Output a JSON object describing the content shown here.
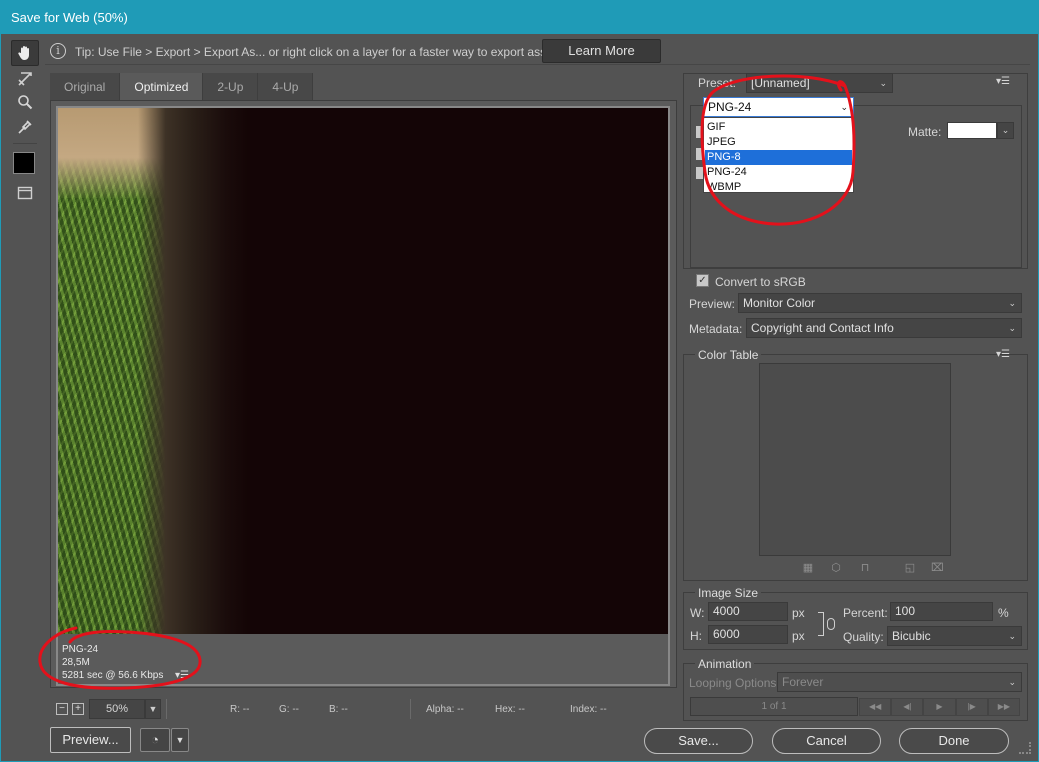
{
  "window": {
    "title": "Save for Web (50%)"
  },
  "tools": [
    {
      "name": "hand-tool-icon",
      "active": true
    },
    {
      "name": "slice-select-tool-icon",
      "active": false
    },
    {
      "name": "zoom-tool-icon",
      "active": false
    },
    {
      "name": "eyedropper-tool-icon",
      "active": false
    },
    {
      "name": "eyedropper-color-swatch",
      "active": false
    },
    {
      "name": "toggle-slices-visibility-icon",
      "active": false
    }
  ],
  "tip": {
    "text": "Tip: Use File > Export > Export As...  or right click on a layer for a faster way to export assets",
    "learn_more": "Learn More"
  },
  "tabs": [
    {
      "label": "Original",
      "active": false
    },
    {
      "label": "Optimized",
      "active": true
    },
    {
      "label": "2-Up",
      "active": false
    },
    {
      "label": "4-Up",
      "active": false
    }
  ],
  "canvas_status": {
    "format": "PNG-24",
    "size": "28,5M",
    "download_time": "5281 sec @ 56.6 Kbps"
  },
  "zoom": {
    "value": "50%",
    "r": "R: --",
    "g": "G: --",
    "b": "B: --",
    "alpha": "Alpha: --",
    "hex": "Hex: --",
    "index": "Index: --"
  },
  "buttons": {
    "preview": "Preview...",
    "save": "Save...",
    "cancel": "Cancel",
    "done": "Done"
  },
  "settings": {
    "preset_label": "Preset:",
    "preset_value": "[Unnamed]",
    "format_value": "PNG-24",
    "format_options": [
      "GIF",
      "JPEG",
      "PNG-8",
      "PNG-24",
      "WBMP"
    ],
    "format_highlighted": "PNG-8",
    "matte_label": "Matte:",
    "convert_srgb_label": "Convert to sRGB",
    "convert_srgb_checked": true,
    "preview_label": "Preview:",
    "preview_value": "Monitor Color",
    "metadata_label": "Metadata:",
    "metadata_value": "Copyright and Contact Info"
  },
  "color_table": {
    "title": "Color Table"
  },
  "image_size": {
    "title": "Image Size",
    "w_label": "W:",
    "w_value": "4000",
    "h_label": "H:",
    "h_value": "6000",
    "unit": "px",
    "percent_label": "Percent:",
    "percent_value": "100",
    "percent_unit": "%",
    "quality_label": "Quality:",
    "quality_value": "Bicubic"
  },
  "animation": {
    "title": "Animation",
    "looping_label": "Looping Options:",
    "looping_value": "Forever",
    "frame_counter": "1 of 1"
  },
  "colors": {
    "title_bar": "#1f9bb7",
    "panel_bg": "#535353",
    "selection_blue": "#1e6fd9",
    "annotation_red": "#e3111b"
  }
}
